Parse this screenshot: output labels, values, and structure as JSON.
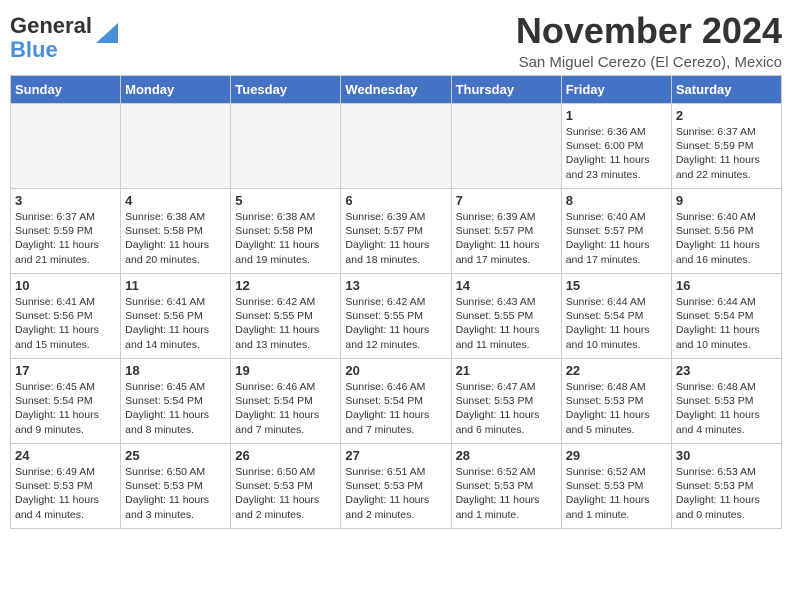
{
  "logo": {
    "general": "General",
    "blue": "Blue"
  },
  "title": "November 2024",
  "subtitle": "San Miguel Cerezo (El Cerezo), Mexico",
  "weekdays": [
    "Sunday",
    "Monday",
    "Tuesday",
    "Wednesday",
    "Thursday",
    "Friday",
    "Saturday"
  ],
  "weeks": [
    [
      {
        "day": "",
        "info": "",
        "empty": true
      },
      {
        "day": "",
        "info": "",
        "empty": true
      },
      {
        "day": "",
        "info": "",
        "empty": true
      },
      {
        "day": "",
        "info": "",
        "empty": true
      },
      {
        "day": "",
        "info": "",
        "empty": true
      },
      {
        "day": "1",
        "info": "Sunrise: 6:36 AM\nSunset: 6:00 PM\nDaylight: 11 hours and 23 minutes."
      },
      {
        "day": "2",
        "info": "Sunrise: 6:37 AM\nSunset: 5:59 PM\nDaylight: 11 hours and 22 minutes."
      }
    ],
    [
      {
        "day": "3",
        "info": "Sunrise: 6:37 AM\nSunset: 5:59 PM\nDaylight: 11 hours and 21 minutes."
      },
      {
        "day": "4",
        "info": "Sunrise: 6:38 AM\nSunset: 5:58 PM\nDaylight: 11 hours and 20 minutes."
      },
      {
        "day": "5",
        "info": "Sunrise: 6:38 AM\nSunset: 5:58 PM\nDaylight: 11 hours and 19 minutes."
      },
      {
        "day": "6",
        "info": "Sunrise: 6:39 AM\nSunset: 5:57 PM\nDaylight: 11 hours and 18 minutes."
      },
      {
        "day": "7",
        "info": "Sunrise: 6:39 AM\nSunset: 5:57 PM\nDaylight: 11 hours and 17 minutes."
      },
      {
        "day": "8",
        "info": "Sunrise: 6:40 AM\nSunset: 5:57 PM\nDaylight: 11 hours and 17 minutes."
      },
      {
        "day": "9",
        "info": "Sunrise: 6:40 AM\nSunset: 5:56 PM\nDaylight: 11 hours and 16 minutes."
      }
    ],
    [
      {
        "day": "10",
        "info": "Sunrise: 6:41 AM\nSunset: 5:56 PM\nDaylight: 11 hours and 15 minutes."
      },
      {
        "day": "11",
        "info": "Sunrise: 6:41 AM\nSunset: 5:56 PM\nDaylight: 11 hours and 14 minutes."
      },
      {
        "day": "12",
        "info": "Sunrise: 6:42 AM\nSunset: 5:55 PM\nDaylight: 11 hours and 13 minutes."
      },
      {
        "day": "13",
        "info": "Sunrise: 6:42 AM\nSunset: 5:55 PM\nDaylight: 11 hours and 12 minutes."
      },
      {
        "day": "14",
        "info": "Sunrise: 6:43 AM\nSunset: 5:55 PM\nDaylight: 11 hours and 11 minutes."
      },
      {
        "day": "15",
        "info": "Sunrise: 6:44 AM\nSunset: 5:54 PM\nDaylight: 11 hours and 10 minutes."
      },
      {
        "day": "16",
        "info": "Sunrise: 6:44 AM\nSunset: 5:54 PM\nDaylight: 11 hours and 10 minutes."
      }
    ],
    [
      {
        "day": "17",
        "info": "Sunrise: 6:45 AM\nSunset: 5:54 PM\nDaylight: 11 hours and 9 minutes."
      },
      {
        "day": "18",
        "info": "Sunrise: 6:45 AM\nSunset: 5:54 PM\nDaylight: 11 hours and 8 minutes."
      },
      {
        "day": "19",
        "info": "Sunrise: 6:46 AM\nSunset: 5:54 PM\nDaylight: 11 hours and 7 minutes."
      },
      {
        "day": "20",
        "info": "Sunrise: 6:46 AM\nSunset: 5:54 PM\nDaylight: 11 hours and 7 minutes."
      },
      {
        "day": "21",
        "info": "Sunrise: 6:47 AM\nSunset: 5:53 PM\nDaylight: 11 hours and 6 minutes."
      },
      {
        "day": "22",
        "info": "Sunrise: 6:48 AM\nSunset: 5:53 PM\nDaylight: 11 hours and 5 minutes."
      },
      {
        "day": "23",
        "info": "Sunrise: 6:48 AM\nSunset: 5:53 PM\nDaylight: 11 hours and 4 minutes."
      }
    ],
    [
      {
        "day": "24",
        "info": "Sunrise: 6:49 AM\nSunset: 5:53 PM\nDaylight: 11 hours and 4 minutes."
      },
      {
        "day": "25",
        "info": "Sunrise: 6:50 AM\nSunset: 5:53 PM\nDaylight: 11 hours and 3 minutes."
      },
      {
        "day": "26",
        "info": "Sunrise: 6:50 AM\nSunset: 5:53 PM\nDaylight: 11 hours and 2 minutes."
      },
      {
        "day": "27",
        "info": "Sunrise: 6:51 AM\nSunset: 5:53 PM\nDaylight: 11 hours and 2 minutes."
      },
      {
        "day": "28",
        "info": "Sunrise: 6:52 AM\nSunset: 5:53 PM\nDaylight: 11 hours and 1 minute."
      },
      {
        "day": "29",
        "info": "Sunrise: 6:52 AM\nSunset: 5:53 PM\nDaylight: 11 hours and 1 minute."
      },
      {
        "day": "30",
        "info": "Sunrise: 6:53 AM\nSunset: 5:53 PM\nDaylight: 11 hours and 0 minutes."
      }
    ]
  ]
}
